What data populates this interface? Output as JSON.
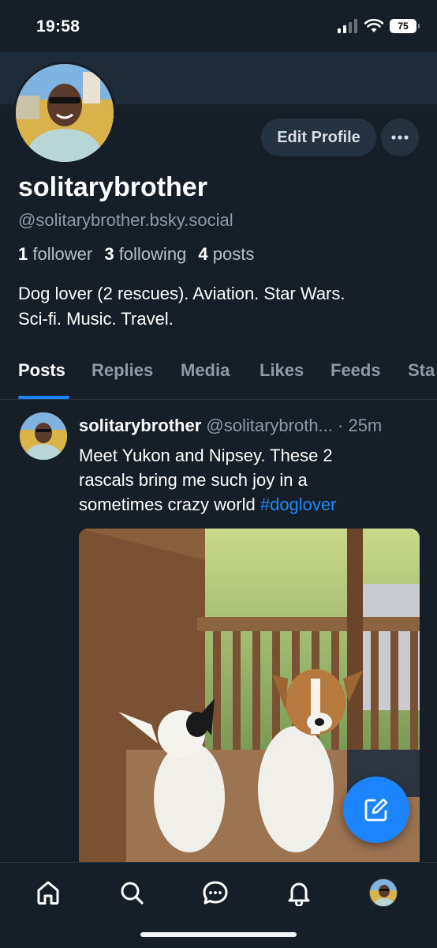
{
  "status_bar": {
    "time": "19:58",
    "battery": "75"
  },
  "profile": {
    "edit_label": "Edit Profile",
    "display_name": "solitarybrother",
    "handle": "@solitarybrother.bsky.social",
    "followers_count": "1",
    "followers_label": "follower",
    "following_count": "3",
    "following_label": "following",
    "posts_count": "4",
    "posts_label": "posts",
    "bio_line1": "Dog lover (2 rescues). Aviation. Star Wars.",
    "bio_line2": "Sci-fi. Music. Travel."
  },
  "tabs": [
    {
      "label": "Posts",
      "active": true
    },
    {
      "label": "Replies"
    },
    {
      "label": "Media"
    },
    {
      "label": "Likes"
    },
    {
      "label": "Feeds"
    },
    {
      "label": "Sta"
    }
  ],
  "post": {
    "author": "solitarybrother",
    "handle": "@solitarybroth...",
    "time": "· 25m",
    "text_line1": "Meet Yukon and Nipsey. These 2",
    "text_line2": "rascals bring me such joy in a",
    "text_line3": "sometimes crazy world",
    "hashtag": "#doglover"
  },
  "nav": {
    "items": [
      "home-icon",
      "search-icon",
      "chat-icon",
      "bell-icon",
      "profile-avatar"
    ]
  },
  "colors": {
    "background": "#161e27",
    "accent": "#1d84ff",
    "link": "#208bfe"
  }
}
